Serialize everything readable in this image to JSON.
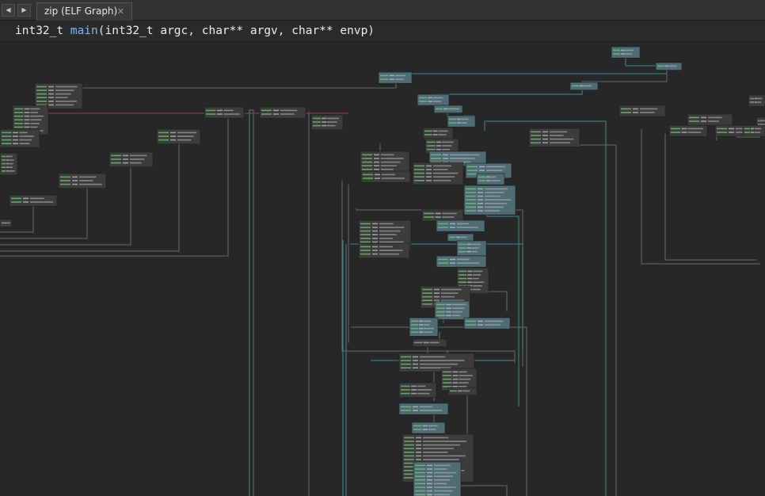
{
  "tabs": {
    "back_icon": "left-triangle-icon",
    "forward_icon": "right-triangle-icon",
    "active_tab_label": "zip (ELF Graph)",
    "close_icon": "close-x-icon"
  },
  "signature": {
    "return_type": "int32_t",
    "function_name": "main",
    "params": [
      {
        "type": "int32_t",
        "name": "argc"
      },
      {
        "type": "char**",
        "name": "argv"
      },
      {
        "type": "char**",
        "name": "envp"
      }
    ]
  },
  "colors": {
    "background": "#272727",
    "block_fill": "#3c3c3c",
    "block_fill_highlight": "#4f6b74",
    "edge_teal": "#3f8c8c",
    "edge_gray": "#6a6a6a",
    "edge_red": "#8a4a4a",
    "address_green": "#7ec47e",
    "mnemonic_gray": "#c8c8c8",
    "operand_light": "#b8b8b8"
  }
}
